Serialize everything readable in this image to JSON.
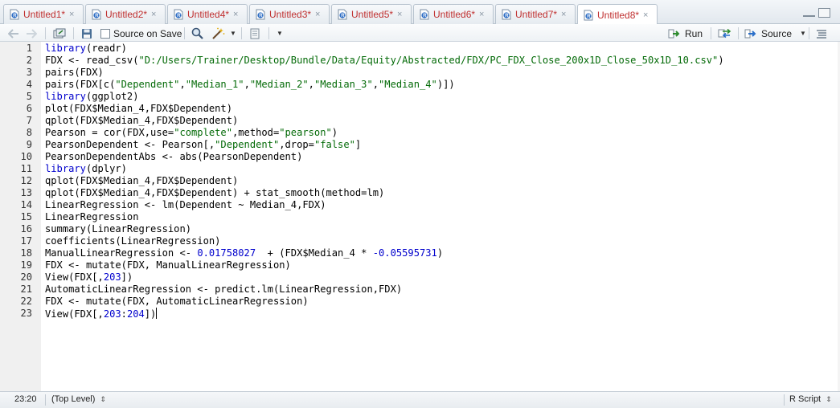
{
  "tabs": [
    {
      "label": "Untitled1*",
      "active": false
    },
    {
      "label": "Untitled2*",
      "active": false
    },
    {
      "label": "Untitled4*",
      "active": false
    },
    {
      "label": "Untitled3*",
      "active": false
    },
    {
      "label": "Untitled5*",
      "active": false
    },
    {
      "label": "Untitled6*",
      "active": false
    },
    {
      "label": "Untitled7*",
      "active": false
    },
    {
      "label": "Untitled8*",
      "active": true
    }
  ],
  "tab_close_glyph": "×",
  "toolbar": {
    "source_on_save_label": "Source on Save",
    "run_label": "Run",
    "source_label": "Source"
  },
  "editor": {
    "line_numbers": [
      "1",
      "2",
      "3",
      "4",
      "5",
      "6",
      "7",
      "8",
      "9",
      "10",
      "11",
      "12",
      "13",
      "14",
      "15",
      "16",
      "17",
      "18",
      "19",
      "20",
      "21",
      "22",
      "23"
    ],
    "lines": [
      "library(readr)",
      "FDX <- read_csv(\"D:/Users/Trainer/Desktop/Bundle/Data/Equity/Abstracted/FDX/PC_FDX_Close_200x1D_Close_50x1D_10.csv\")",
      "pairs(FDX)",
      "pairs(FDX[c(\"Dependent\",\"Median_1\",\"Median_2\",\"Median_3\",\"Median_4\")])",
      "library(ggplot2)",
      "plot(FDX$Median_4,FDX$Dependent)",
      "qplot(FDX$Median_4,FDX$Dependent)",
      "Pearson = cor(FDX,use=\"complete\",method=\"pearson\")",
      "PearsonDependent <- Pearson[,\"Dependent\",drop=\"false\"]",
      "PearsonDependentAbs <- abs(PearsonDependent)",
      "library(dplyr)",
      "qplot(FDX$Median_4,FDX$Dependent)",
      "qplot(FDX$Median_4,FDX$Dependent) + stat_smooth(method=lm)",
      "LinearRegression <- lm(Dependent ~ Median_4,FDX)",
      "LinearRegression",
      "summary(LinearRegression)",
      "coefficients(LinearRegression)",
      "ManualLinearRegression <- 0.01758027  + (FDX$Median_4 * -0.05595731)",
      "FDX <- mutate(FDX, ManualLinearRegression)",
      "View(FDX[,203])",
      "AutomaticLinearRegression <- predict.lm(LinearRegression,FDX)",
      "FDX <- mutate(FDX, AutomaticLinearRegression)",
      "View(FDX[,203:204])"
    ]
  },
  "status": {
    "cursor_position": "23:20",
    "scope": "(Top Level)",
    "file_type": "R Script"
  },
  "colors": {
    "keyword": "#0000cc",
    "string": "#036a07",
    "number": "#0000cd",
    "tab_label": "#c03030"
  }
}
